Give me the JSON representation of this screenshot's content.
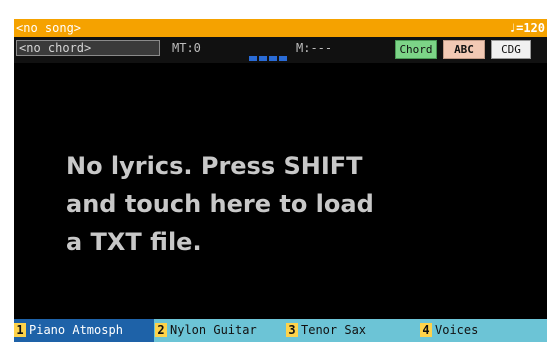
{
  "header": {
    "song": "<no song>",
    "tempo": "♩=120"
  },
  "info": {
    "chord": "<no chord>",
    "mt": "MT:0",
    "beat_count": 4,
    "measure": "M:---",
    "buttons": {
      "chord": "Chord",
      "abc": "ABC",
      "cdg": "CDG"
    }
  },
  "lyrics": {
    "message": "No lyrics. Press SHIFT\nand touch here to load\na TXT file."
  },
  "tracks": [
    {
      "number": "1",
      "name": "Piano Atmosph"
    },
    {
      "number": "2",
      "name": "Nylon Guitar"
    },
    {
      "number": "3",
      "name": "Tenor Sax"
    },
    {
      "number": "4",
      "name": "Voices"
    }
  ],
  "colors": {
    "song_bar": "#f5a200",
    "chord_button": "#7cd487",
    "abc_button": "#f2c9b4",
    "track_bar": "#6cc4d6",
    "selected_track": "#1e62a8",
    "track_number": "#ffd34a"
  }
}
